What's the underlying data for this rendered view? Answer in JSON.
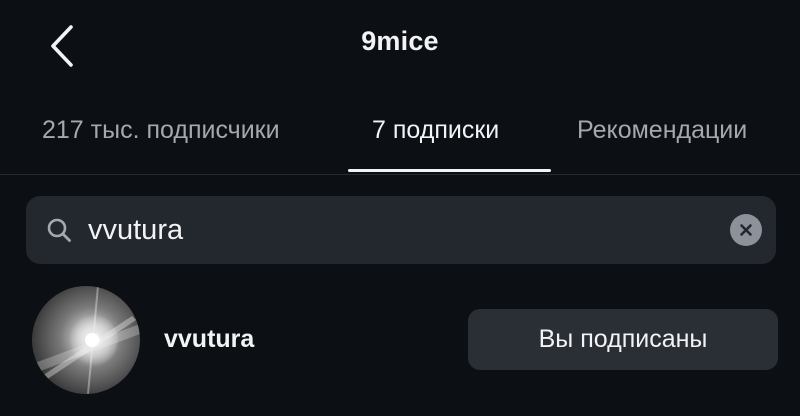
{
  "header": {
    "title": "9mice",
    "back_icon": "chevron-left-icon"
  },
  "tabs": [
    {
      "label": "217 тыс. подписчики",
      "active": false
    },
    {
      "label": "7 подписки",
      "active": true
    },
    {
      "label": "Рекомендации",
      "active": false
    }
  ],
  "search": {
    "value": "vvutura",
    "icon": "search-icon",
    "clear_icon": "clear-icon"
  },
  "results": [
    {
      "username": "vvutura",
      "button_label": "Вы подписаны"
    }
  ],
  "colors": {
    "background": "#0c0f14",
    "search_bg": "#23272e",
    "button_bg": "#2a2e35",
    "text_primary": "#f2f3f5",
    "text_secondary": "#a4a8af"
  }
}
